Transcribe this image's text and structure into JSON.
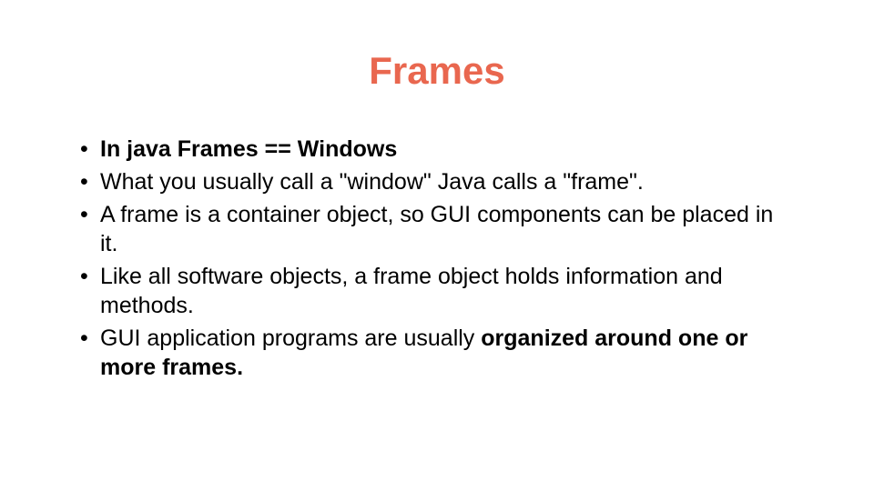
{
  "title": "Frames",
  "bullets": {
    "b1_bold": "In java Frames == Windows",
    "b2": "What you usually call a \"window\" Java calls a \"frame\".",
    "b3": "A frame is a container object, so GUI components can be placed in it.",
    "b4": "Like all software objects, a frame object holds information and methods.",
    "b5_pre": "GUI application programs are usually ",
    "b5_bold": "organized around one or more frames."
  }
}
